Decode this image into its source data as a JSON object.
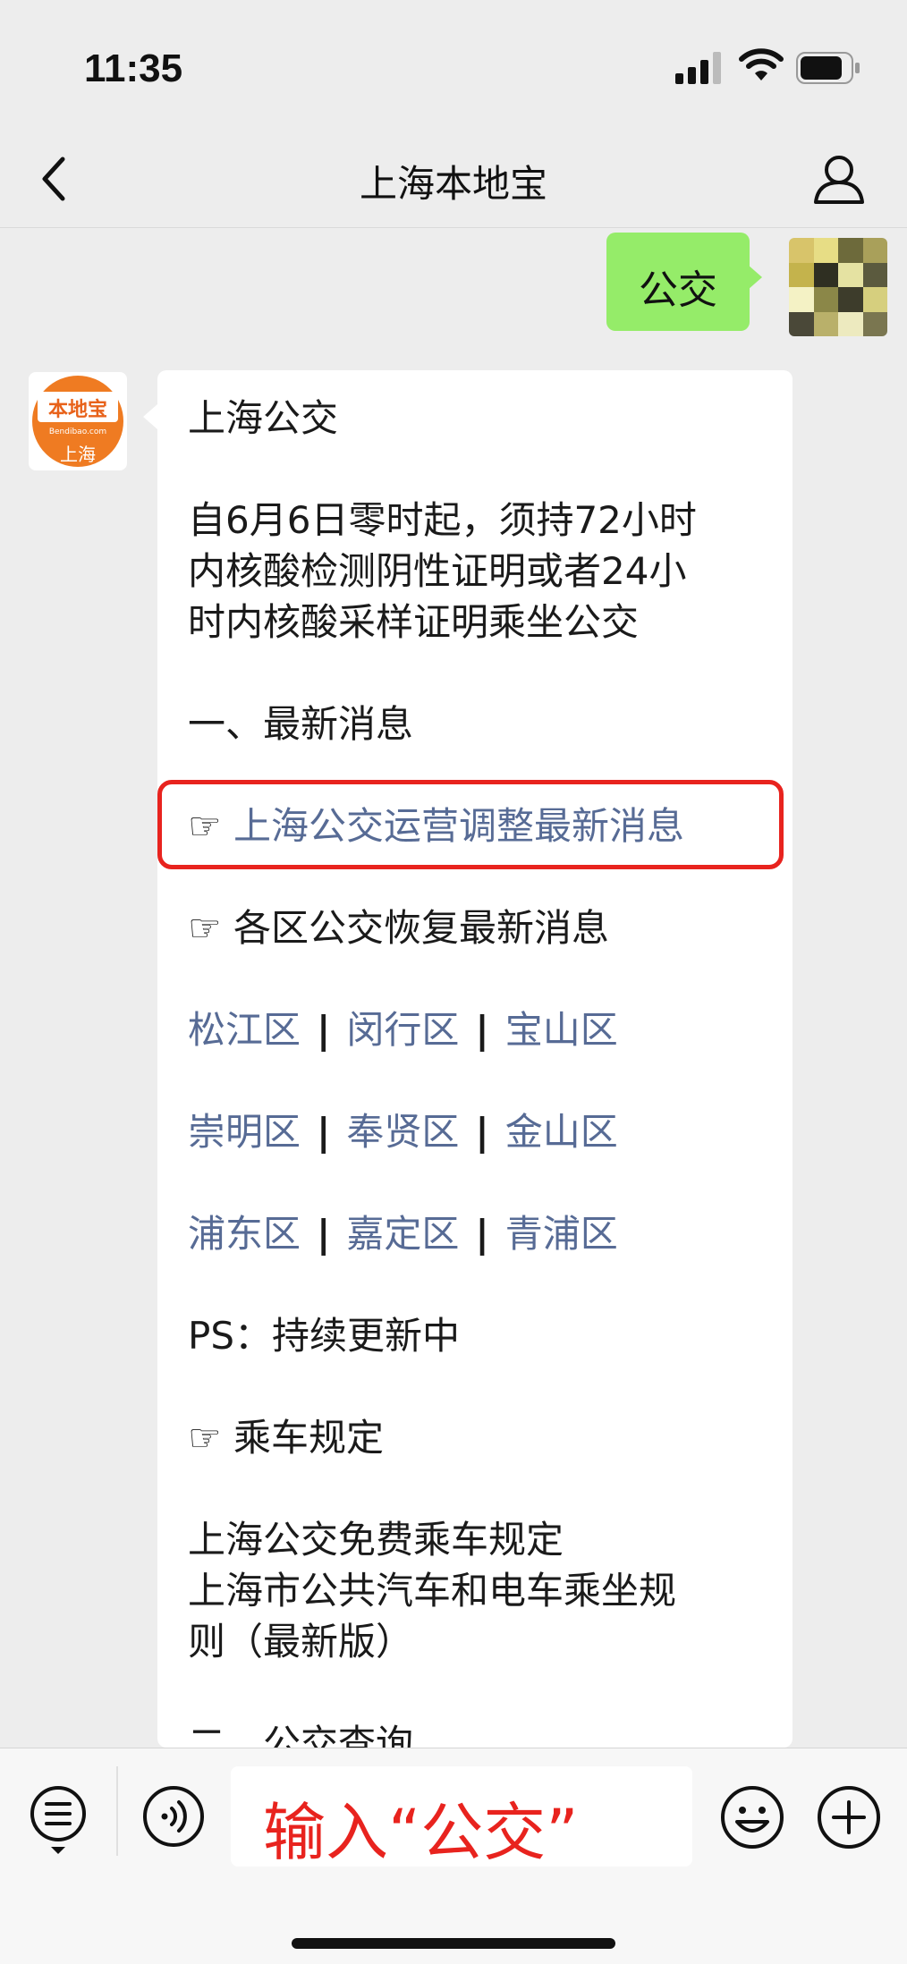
{
  "status_bar": {
    "time": "11:35"
  },
  "nav": {
    "title": "上海本地宝"
  },
  "sent_message": {
    "text": "公交"
  },
  "bot_avatar": {
    "brand": "本地宝",
    "domain": "Bendibao.com",
    "city": "上海"
  },
  "reply": {
    "title": "上海公交",
    "notice_lines": [
      "自6月6日零时起，须持72小时",
      "内核酸检测阴性证明或者24小",
      "时内核酸采样证明乘坐公交"
    ],
    "section1": "一、最新消息",
    "pointer_icon": "☞",
    "news_link": "上海公交运营调整最新消息",
    "district_heading": "各区公交恢复最新消息",
    "district_rows": [
      [
        "松江区",
        "闵行区",
        "宝山区"
      ],
      [
        "崇明区",
        "奉贤区",
        "金山区"
      ],
      [
        "浦东区",
        "嘉定区",
        "青浦区"
      ]
    ],
    "separator": "|",
    "ps": "PS：持续更新中",
    "rules_heading": "乘车规定",
    "rule_links": [
      "上海公交免费乘车规定",
      "上海市公共汽车和电车乘坐规",
      "则（最新版）"
    ],
    "section2": "二、公交查询"
  },
  "input": {
    "text": "输入“公交”"
  },
  "colors": {
    "link": "#576b95",
    "highlight": "#e8231e",
    "sent_bubble": "#95ec69",
    "brand_orange": "#ef7b22"
  },
  "icons": [
    "back-arrow-icon",
    "profile-icon",
    "menu-list-icon",
    "voice-icon",
    "emoji-icon",
    "plus-icon",
    "signal-icon",
    "wifi-icon",
    "battery-icon"
  ]
}
